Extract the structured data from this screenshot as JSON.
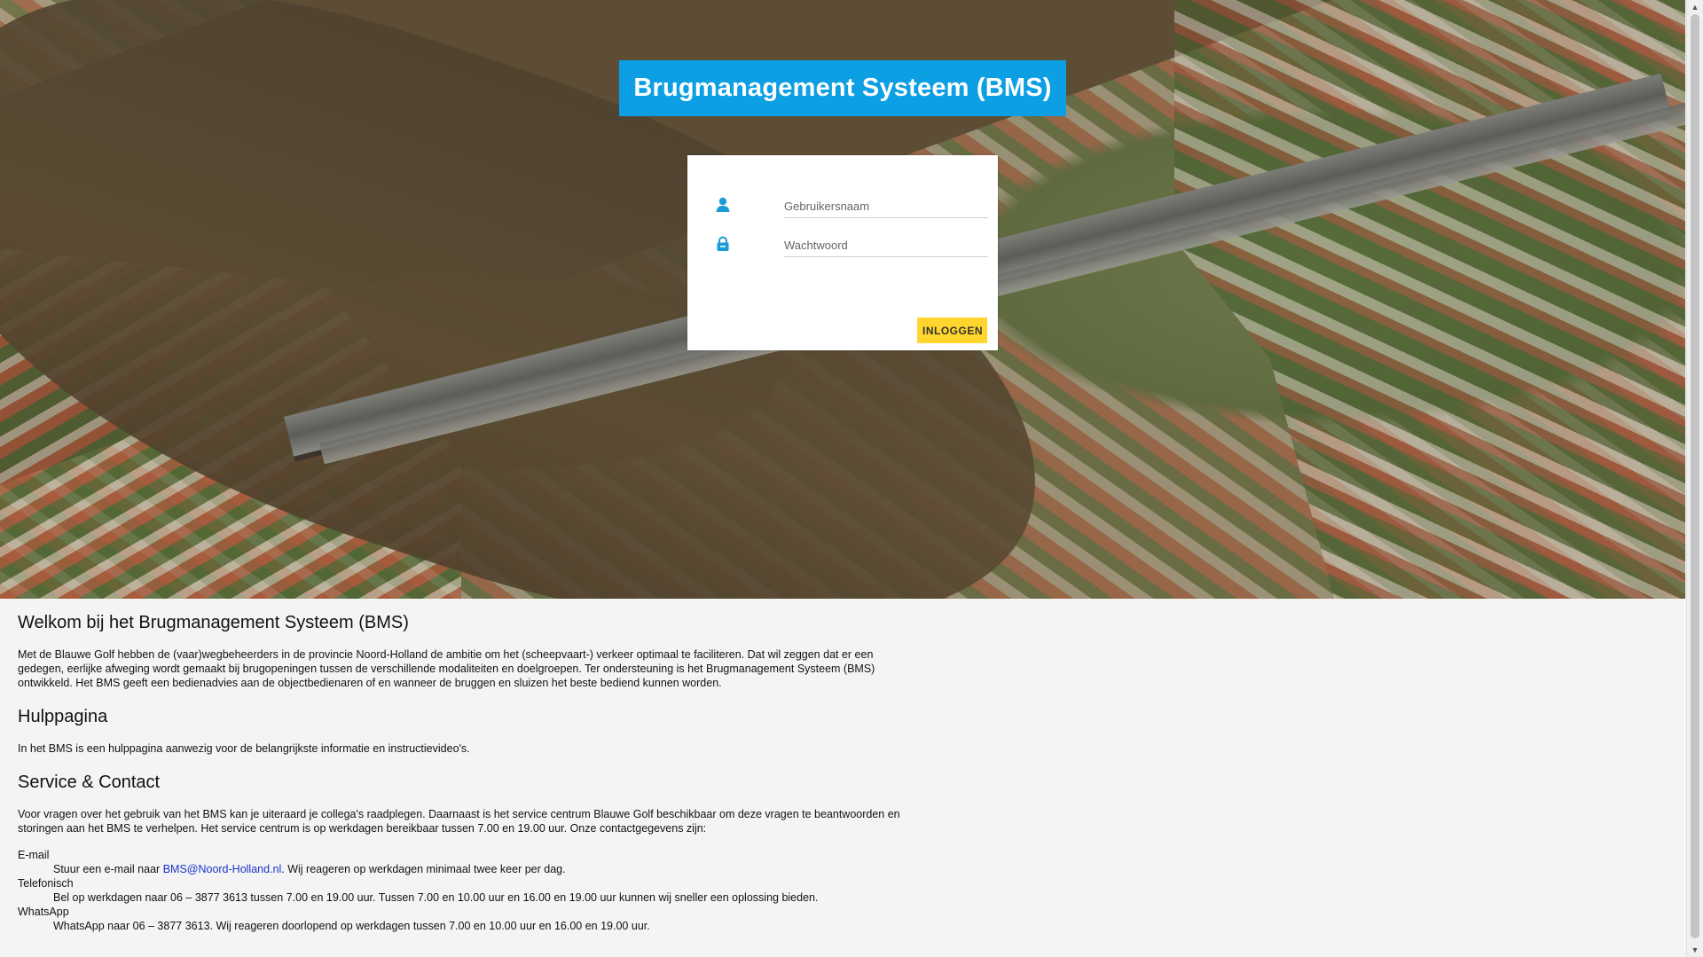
{
  "header": {
    "title": "Brugmanagement Systeem (BMS)"
  },
  "login": {
    "username_placeholder": "Gebruikersnaam",
    "password_placeholder": "Wachtwoord",
    "button_label": "INLOGGEN"
  },
  "content": {
    "welcome_heading": "Welkom bij het Brugmanagement Systeem (BMS)",
    "welcome_text": "Met de Blauwe Golf hebben de (vaar)wegbeheerders in de provincie Noord-Holland de ambitie om het (scheepvaart-) verkeer optimaal te faciliteren. Dat wil zeggen dat er een gedegen, eerlijke afweging wordt gemaakt bij brugopeningen tussen de verschillende modaliteiten en doelgroepen. Ter ondersteuning is het Brugmanagement Systeem (BMS) ontwikkeld. Het BMS geeft een bedienadvies aan de objectbedienaren of en wanneer de bruggen en sluizen het beste bediend kunnen worden.",
    "help_heading": "Hulppagina",
    "help_text": "In het BMS is een hulppagina aanwezig voor de belangrijkste informatie en instructievideo's.",
    "contact_heading": "Service & Contact",
    "contact_text": "Voor vragen over het gebruik van het BMS kan je uiteraard je collega's raadplegen. Daarnaast is het service centrum Blauwe Golf beschikbaar om deze vragen te beantwoorden en storingen aan het BMS te verhelpen. Het service centrum is op werkdagen bereikbaar tussen 7.00 en 19.00 uur. Onze contactgegevens zijn:",
    "email": {
      "label": "E-mail",
      "prefix": "Stuur een e-mail naar ",
      "address": "BMS@Noord-Holland.nl",
      "suffix": ". Wij reageren op werkdagen minimaal twee keer per dag."
    },
    "phone": {
      "label": "Telefonisch",
      "text": "Bel op werkdagen naar 06 – 3877 3613 tussen 7.00 en 19.00 uur. Tussen 7.00 en 10.00 uur en 16.00 en 19.00 uur kunnen wij sneller een oplossing bieden."
    },
    "whatsapp": {
      "label": "WhatsApp",
      "text": "WhatsApp naar 06 – 3877 3613. Wij reageren doorlopend op werkdagen tussen 7.00 en 10.00 uur en 16.00 en 19.00 uur."
    }
  },
  "icons": {
    "username": "user-icon",
    "password": "lock-icon"
  },
  "colors": {
    "banner": "#0c9fe3",
    "login_button": "#ffd52e",
    "icon": "#1a9ad6",
    "link": "#1a33cc"
  }
}
